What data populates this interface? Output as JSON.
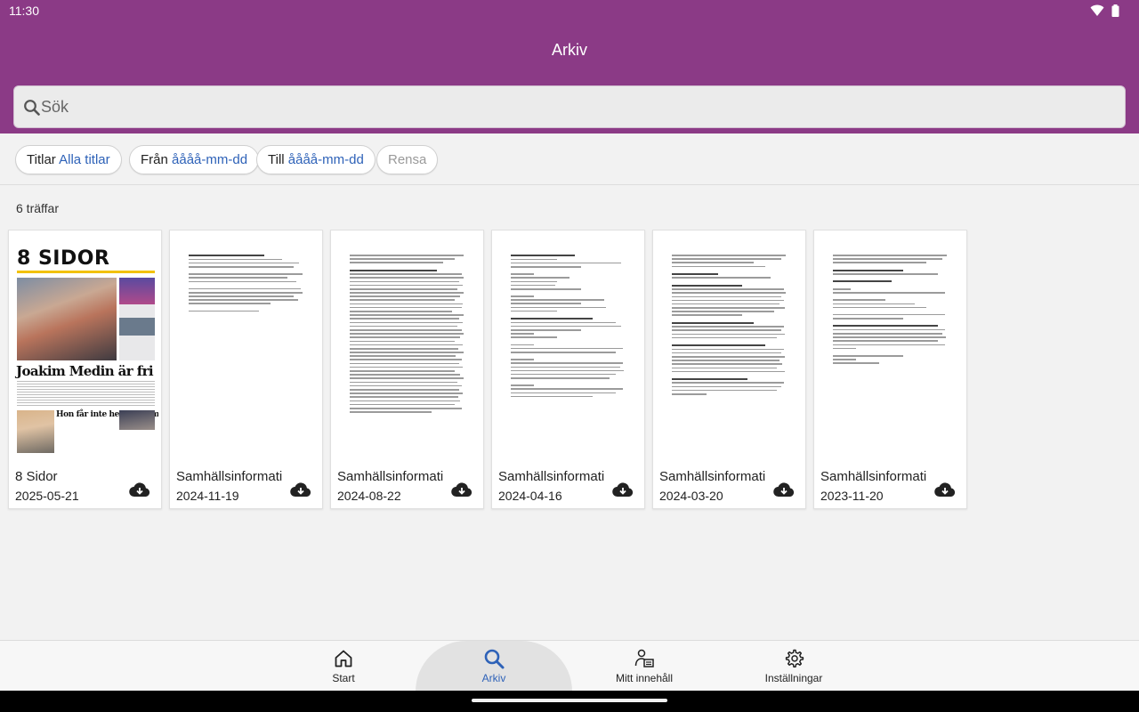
{
  "status_bar": {
    "time": "11:30"
  },
  "header": {
    "title": "Arkiv",
    "search_placeholder": "Sök"
  },
  "filters": {
    "titles_label": "Titlar",
    "titles_value": "Alla titlar",
    "from_label": "Från",
    "from_value": "åååå-mm-dd",
    "to_label": "Till",
    "to_value": "åååå-mm-dd",
    "clear_label": "Rensa"
  },
  "results": {
    "count_text": "6 träffar",
    "items": [
      {
        "title": "8 Sidor",
        "date": "2025-05-21"
      },
      {
        "title": "Samhällsinformati",
        "date": "2024-11-19"
      },
      {
        "title": "Samhällsinformati",
        "date": "2024-08-22"
      },
      {
        "title": "Samhällsinformati",
        "date": "2024-04-16"
      },
      {
        "title": "Samhällsinformati",
        "date": "2024-03-20"
      },
      {
        "title": "Samhällsinformati",
        "date": "2023-11-20"
      }
    ]
  },
  "cover": {
    "masthead": "8 SIDOR",
    "headline": "Joakim Medin är fri",
    "subheadline": "Hon får inte heta mamma"
  },
  "bottom_nav": {
    "items": [
      {
        "label": "Start",
        "icon": "home-icon"
      },
      {
        "label": "Arkiv",
        "icon": "search-icon"
      },
      {
        "label": "Mitt innehåll",
        "icon": "my-content-icon"
      },
      {
        "label": "Inställningar",
        "icon": "settings-gear-icon"
      }
    ],
    "active": "Arkiv"
  },
  "colors": {
    "brand": "#8b3a86",
    "accent_link": "#2e62b8",
    "background": "#f2f2f2"
  }
}
